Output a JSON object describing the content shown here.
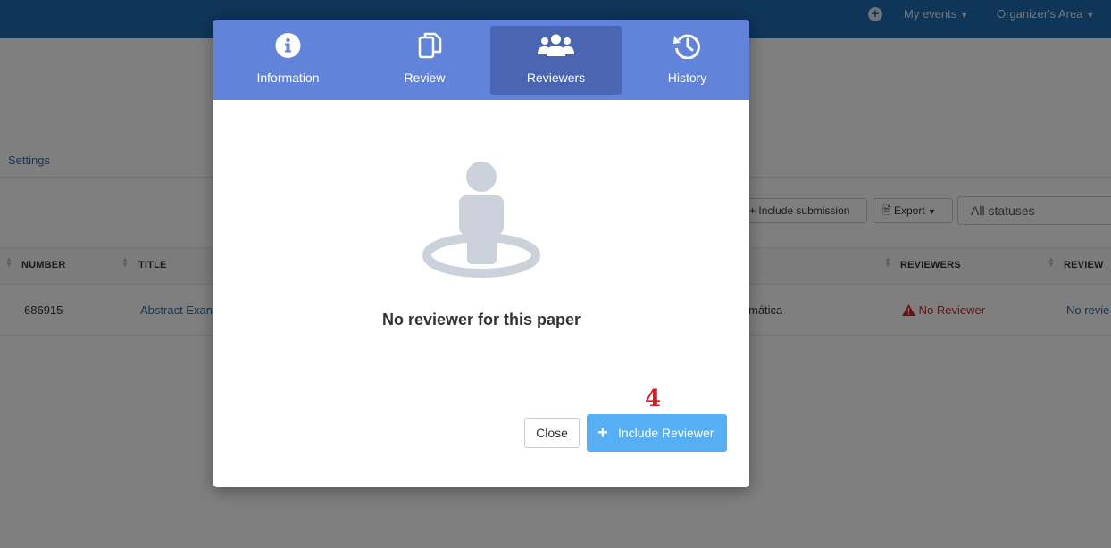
{
  "topbar": {
    "add_icon": "plus-circle-icon",
    "my_events": "My events",
    "organizers_area": "Organizer's Area"
  },
  "page": {
    "settings_link": "Settings",
    "include_submission": "Include submission",
    "export": "Export",
    "status_filter": "All statuses"
  },
  "table": {
    "headers": {
      "number": "NUMBER",
      "title": "TITLE",
      "reviewers": "REVIEWERS",
      "review": "REVIEW"
    },
    "rows": [
      {
        "number": "686915",
        "title": "Abstract Exan",
        "area": "mática",
        "reviewers": "No Reviewer",
        "review": "No revie"
      }
    ]
  },
  "modal": {
    "tabs": [
      {
        "label": "Information",
        "icon": "info-circle-icon",
        "active": false
      },
      {
        "label": "Review",
        "icon": "copy-icon",
        "active": false
      },
      {
        "label": "Reviewers",
        "icon": "users-icon",
        "active": true
      },
      {
        "label": "History",
        "icon": "history-icon",
        "active": false
      }
    ],
    "empty_message": "No reviewer for this paper",
    "step_marker": "4",
    "close_label": "Close",
    "include_reviewer_label": "Include Reviewer"
  },
  "colors": {
    "topbar": "#1e6ab0",
    "modal_tabs_bg": "#6183d9",
    "active_tab": "#4a66b2",
    "primary_button": "#56aef4",
    "marker": "#e0181e",
    "warning": "#c62828"
  }
}
